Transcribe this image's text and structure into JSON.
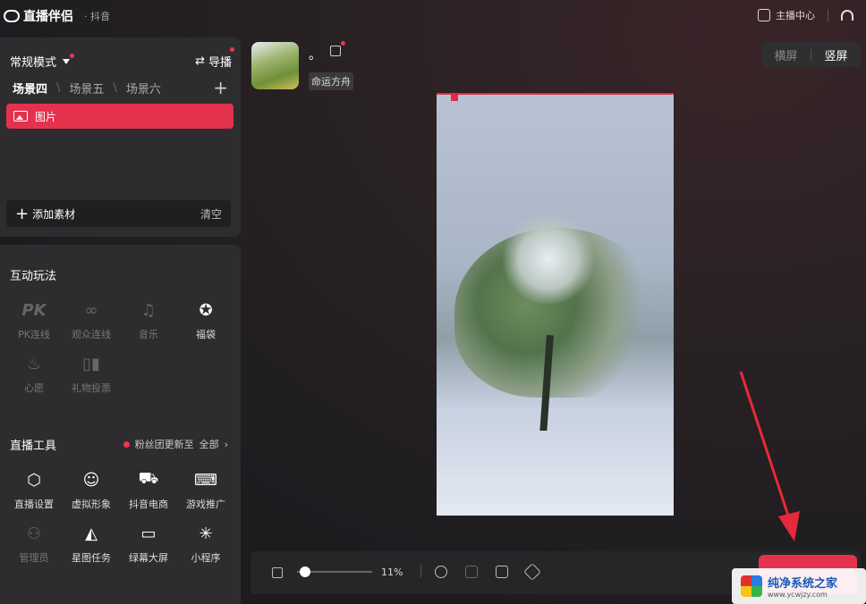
{
  "app": {
    "title": "直播伴侣",
    "platform": "· 抖音"
  },
  "topbar": {
    "creator_center": "主播中心"
  },
  "scene": {
    "mode": "常规模式",
    "guide": "导播",
    "tabs": [
      "场景四",
      "场景五",
      "场景六"
    ],
    "sources": [
      {
        "label": "图片"
      }
    ],
    "add_material": "添加素材",
    "clear": "清空"
  },
  "interactive": {
    "title": "互动玩法",
    "items": [
      {
        "label": "PK连线",
        "icon": "pk-icon",
        "enabled": false
      },
      {
        "label": "观众连线",
        "icon": "link-icon",
        "enabled": false
      },
      {
        "label": "音乐",
        "icon": "music-icon",
        "enabled": false
      },
      {
        "label": "福袋",
        "icon": "lucky-bag-icon",
        "enabled": true
      },
      {
        "label": "心愿",
        "icon": "wish-lamp-icon",
        "enabled": false
      },
      {
        "label": "礼物投票",
        "icon": "gift-vote-icon",
        "enabled": false
      }
    ]
  },
  "tools": {
    "title": "直播工具",
    "fans_update": "粉丝团更新至",
    "all": "全部",
    "items": [
      {
        "label": "直播设置",
        "icon": "hexagon-settings-icon",
        "enabled": true
      },
      {
        "label": "虚拟形象",
        "icon": "avatar-face-icon",
        "enabled": true
      },
      {
        "label": "抖音电商",
        "icon": "cart-icon",
        "enabled": true
      },
      {
        "label": "游戏推广",
        "icon": "gamepad-icon",
        "enabled": true
      },
      {
        "label": "管理员",
        "icon": "admin-icon",
        "enabled": false
      },
      {
        "label": "星图任务",
        "icon": "star-map-icon",
        "enabled": true
      },
      {
        "label": "绿幕大屏",
        "icon": "monitor-icon",
        "enabled": true
      },
      {
        "label": "小程序",
        "icon": "mini-program-icon",
        "enabled": true
      }
    ]
  },
  "host": {
    "name": "。",
    "tag": "命运方舟"
  },
  "orientation": {
    "landscape": "横屏",
    "portrait": "竖屏",
    "selected": "portrait"
  },
  "controls": {
    "zoom": "11%",
    "zoom_level": 0.11
  },
  "watermark": {
    "name": "纯净系统之家",
    "url": "www.ycwjzy.com"
  },
  "colors": {
    "accent": "#e4324e",
    "panel": "#2d2d30"
  }
}
